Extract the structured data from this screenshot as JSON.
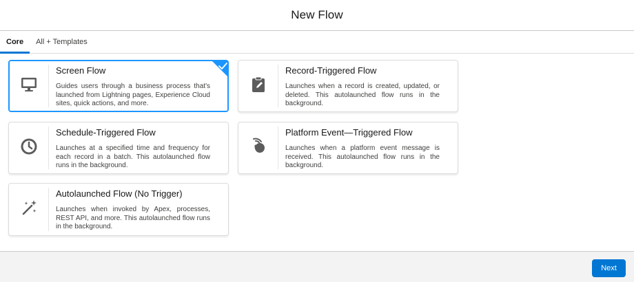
{
  "header": {
    "title": "New Flow"
  },
  "tabs": [
    {
      "label": "Core",
      "active": true
    },
    {
      "label": "All + Templates",
      "active": false
    }
  ],
  "cards": [
    {
      "title": "Screen Flow",
      "description": "Guides users through a business process that's launched from Lightning pages, Experience Cloud sites, quick actions, and more.",
      "icon": "desktop-icon",
      "selected": true
    },
    {
      "title": "Record-Triggered Flow",
      "description": "Launches when a record is created, updated, or deleted. This autolaunched flow runs in the background.",
      "icon": "clipboard-icon",
      "selected": false
    },
    {
      "title": "Schedule-Triggered Flow",
      "description": "Launches at a specified time and frequency for each record in a batch. This autolaunched flow runs in the background.",
      "icon": "clock-icon",
      "selected": false
    },
    {
      "title": "Platform Event—Triggered Flow",
      "description": "Launches when a platform event message is received. This autolaunched flow runs in the background.",
      "icon": "signal-icon",
      "selected": false
    },
    {
      "title": "Autolaunched Flow (No Trigger)",
      "description": "Launches when invoked by Apex, processes, REST API, and more. This autolaunched flow runs in the background.",
      "icon": "magic-wand-icon",
      "selected": false
    }
  ],
  "footer": {
    "next_label": "Next"
  },
  "colors": {
    "accent": "#0176d3",
    "selected_border": "#1b96ff",
    "icon": "#706e6b"
  }
}
